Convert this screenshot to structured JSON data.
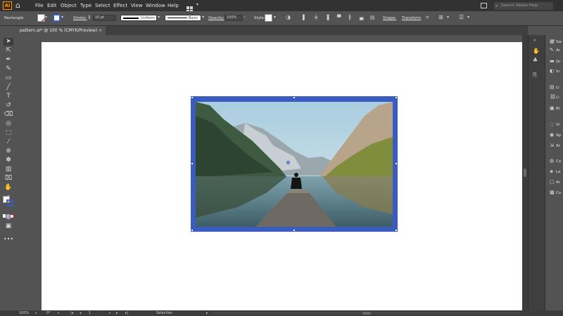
{
  "app": {
    "logo_text": "Ai"
  },
  "menu": [
    "File",
    "Edit",
    "Object",
    "Type",
    "Select",
    "Effect",
    "View",
    "Window",
    "Help"
  ],
  "search": {
    "placeholder": "Search Adobe Help"
  },
  "control_bar": {
    "selection_type": "Rectangle",
    "stroke_label": "Stroke:",
    "stroke_value": "10 pt",
    "profile_label": "Uniform",
    "brush_label": "Basic",
    "opacity_label": "Opacity:",
    "opacity_value": "100%",
    "style_label": "Style:",
    "shape_label": "Shape:",
    "transform_label": "Transform"
  },
  "document_tab": {
    "title": "pattern.ai* @ 100 % (CMYK/Preview)",
    "close": "×"
  },
  "right_panel": {
    "items": [
      "Sw",
      "Ar",
      "Gr",
      "In",
      "Li",
      "Li",
      "Br",
      "Vi",
      "Ap",
      "Ar",
      "Co",
      "La",
      "Ar",
      "Co"
    ]
  },
  "status_bar": {
    "zoom": "100%",
    "rotation": "0°",
    "artboard_number": "1",
    "mode": "Selection"
  },
  "colors": {
    "selection": "#3a5bc0",
    "canvas": "#535353",
    "menubar": "#323232"
  }
}
